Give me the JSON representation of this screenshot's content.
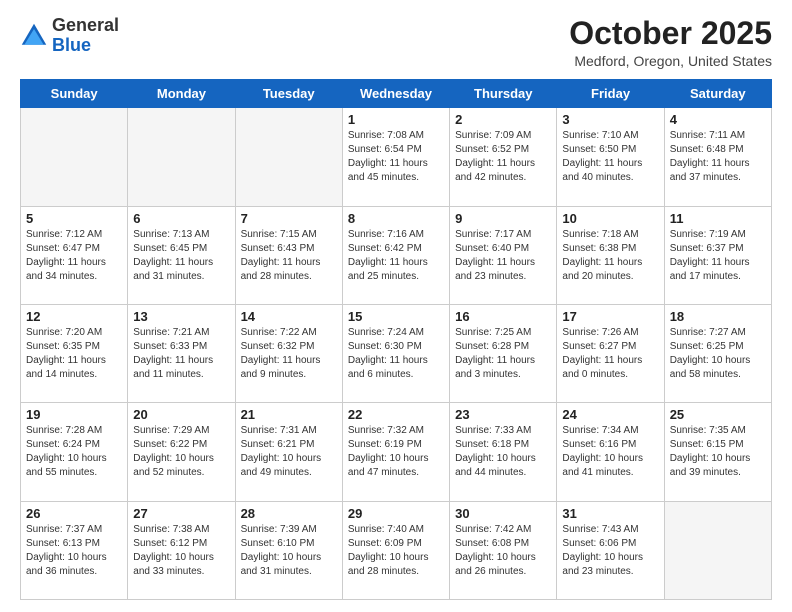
{
  "header": {
    "logo_general": "General",
    "logo_blue": "Blue",
    "month_title": "October 2025",
    "location": "Medford, Oregon, United States"
  },
  "weekdays": [
    "Sunday",
    "Monday",
    "Tuesday",
    "Wednesday",
    "Thursday",
    "Friday",
    "Saturday"
  ],
  "weeks": [
    [
      {
        "day": "",
        "info": ""
      },
      {
        "day": "",
        "info": ""
      },
      {
        "day": "",
        "info": ""
      },
      {
        "day": "1",
        "info": "Sunrise: 7:08 AM\nSunset: 6:54 PM\nDaylight: 11 hours and 45 minutes."
      },
      {
        "day": "2",
        "info": "Sunrise: 7:09 AM\nSunset: 6:52 PM\nDaylight: 11 hours and 42 minutes."
      },
      {
        "day": "3",
        "info": "Sunrise: 7:10 AM\nSunset: 6:50 PM\nDaylight: 11 hours and 40 minutes."
      },
      {
        "day": "4",
        "info": "Sunrise: 7:11 AM\nSunset: 6:48 PM\nDaylight: 11 hours and 37 minutes."
      }
    ],
    [
      {
        "day": "5",
        "info": "Sunrise: 7:12 AM\nSunset: 6:47 PM\nDaylight: 11 hours and 34 minutes."
      },
      {
        "day": "6",
        "info": "Sunrise: 7:13 AM\nSunset: 6:45 PM\nDaylight: 11 hours and 31 minutes."
      },
      {
        "day": "7",
        "info": "Sunrise: 7:15 AM\nSunset: 6:43 PM\nDaylight: 11 hours and 28 minutes."
      },
      {
        "day": "8",
        "info": "Sunrise: 7:16 AM\nSunset: 6:42 PM\nDaylight: 11 hours and 25 minutes."
      },
      {
        "day": "9",
        "info": "Sunrise: 7:17 AM\nSunset: 6:40 PM\nDaylight: 11 hours and 23 minutes."
      },
      {
        "day": "10",
        "info": "Sunrise: 7:18 AM\nSunset: 6:38 PM\nDaylight: 11 hours and 20 minutes."
      },
      {
        "day": "11",
        "info": "Sunrise: 7:19 AM\nSunset: 6:37 PM\nDaylight: 11 hours and 17 minutes."
      }
    ],
    [
      {
        "day": "12",
        "info": "Sunrise: 7:20 AM\nSunset: 6:35 PM\nDaylight: 11 hours and 14 minutes."
      },
      {
        "day": "13",
        "info": "Sunrise: 7:21 AM\nSunset: 6:33 PM\nDaylight: 11 hours and 11 minutes."
      },
      {
        "day": "14",
        "info": "Sunrise: 7:22 AM\nSunset: 6:32 PM\nDaylight: 11 hours and 9 minutes."
      },
      {
        "day": "15",
        "info": "Sunrise: 7:24 AM\nSunset: 6:30 PM\nDaylight: 11 hours and 6 minutes."
      },
      {
        "day": "16",
        "info": "Sunrise: 7:25 AM\nSunset: 6:28 PM\nDaylight: 11 hours and 3 minutes."
      },
      {
        "day": "17",
        "info": "Sunrise: 7:26 AM\nSunset: 6:27 PM\nDaylight: 11 hours and 0 minutes."
      },
      {
        "day": "18",
        "info": "Sunrise: 7:27 AM\nSunset: 6:25 PM\nDaylight: 10 hours and 58 minutes."
      }
    ],
    [
      {
        "day": "19",
        "info": "Sunrise: 7:28 AM\nSunset: 6:24 PM\nDaylight: 10 hours and 55 minutes."
      },
      {
        "day": "20",
        "info": "Sunrise: 7:29 AM\nSunset: 6:22 PM\nDaylight: 10 hours and 52 minutes."
      },
      {
        "day": "21",
        "info": "Sunrise: 7:31 AM\nSunset: 6:21 PM\nDaylight: 10 hours and 49 minutes."
      },
      {
        "day": "22",
        "info": "Sunrise: 7:32 AM\nSunset: 6:19 PM\nDaylight: 10 hours and 47 minutes."
      },
      {
        "day": "23",
        "info": "Sunrise: 7:33 AM\nSunset: 6:18 PM\nDaylight: 10 hours and 44 minutes."
      },
      {
        "day": "24",
        "info": "Sunrise: 7:34 AM\nSunset: 6:16 PM\nDaylight: 10 hours and 41 minutes."
      },
      {
        "day": "25",
        "info": "Sunrise: 7:35 AM\nSunset: 6:15 PM\nDaylight: 10 hours and 39 minutes."
      }
    ],
    [
      {
        "day": "26",
        "info": "Sunrise: 7:37 AM\nSunset: 6:13 PM\nDaylight: 10 hours and 36 minutes."
      },
      {
        "day": "27",
        "info": "Sunrise: 7:38 AM\nSunset: 6:12 PM\nDaylight: 10 hours and 33 minutes."
      },
      {
        "day": "28",
        "info": "Sunrise: 7:39 AM\nSunset: 6:10 PM\nDaylight: 10 hours and 31 minutes."
      },
      {
        "day": "29",
        "info": "Sunrise: 7:40 AM\nSunset: 6:09 PM\nDaylight: 10 hours and 28 minutes."
      },
      {
        "day": "30",
        "info": "Sunrise: 7:42 AM\nSunset: 6:08 PM\nDaylight: 10 hours and 26 minutes."
      },
      {
        "day": "31",
        "info": "Sunrise: 7:43 AM\nSunset: 6:06 PM\nDaylight: 10 hours and 23 minutes."
      },
      {
        "day": "",
        "info": ""
      }
    ]
  ]
}
